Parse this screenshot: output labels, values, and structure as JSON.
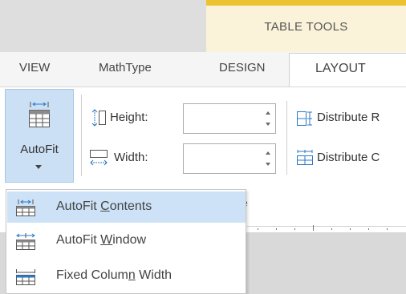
{
  "contextual": {
    "label": "TABLE TOOLS",
    "accent": "#ecc32e"
  },
  "tabs": {
    "view": "VIEW",
    "mathtype": "MathType",
    "design": "DESIGN",
    "layout": "LAYOUT"
  },
  "autofit": {
    "label": "AutoFit",
    "icon": "autofit-table-icon"
  },
  "cell_size": {
    "height_label": "Height:",
    "height_value": "",
    "width_label": "Width:",
    "width_value": "",
    "group_label_fragment": "ze"
  },
  "distribute": {
    "rows_label": "Distribute R",
    "cols_label": "Distribute C"
  },
  "menu": {
    "items": [
      {
        "pre": "AutoFit ",
        "key": "C",
        "post": "ontents",
        "icon": "autofit-contents-icon",
        "selected": true
      },
      {
        "pre": "AutoFit ",
        "key": "W",
        "post": "indow",
        "icon": "autofit-window-icon",
        "selected": false
      },
      {
        "pre": "Fixed Colum",
        "key": "n",
        "post": " Width",
        "icon": "fixed-column-width-icon",
        "selected": false
      }
    ]
  },
  "colors": {
    "highlight": "#cde2f6",
    "button_active": "#cce0f5",
    "icon_blue": "#2b78c5"
  }
}
